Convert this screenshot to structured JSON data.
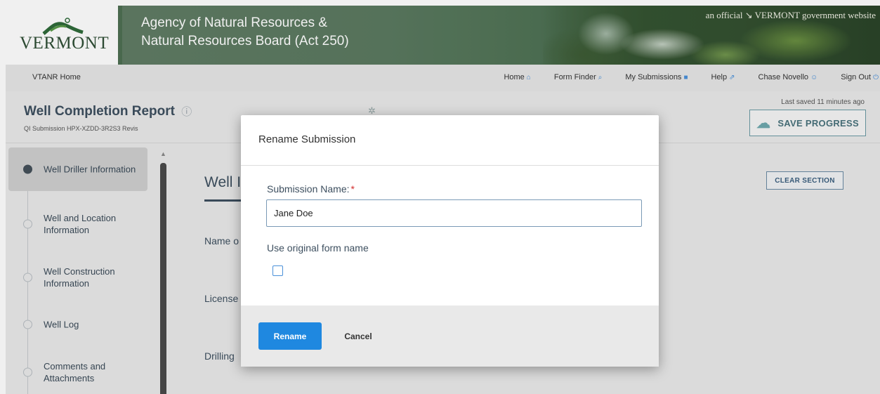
{
  "banner": {
    "logo_text": "VERMONT",
    "agency_line1": "Agency of Natural Resources &",
    "agency_line2": "Natural Resources Board (Act 250)",
    "official": "an official ↘ VERMONT government website"
  },
  "nav": {
    "home_link": "VTANR Home",
    "items": [
      {
        "label": "Home",
        "icon": "⌂"
      },
      {
        "label": "Form Finder",
        "icon": "⌕"
      },
      {
        "label": "My Submissions",
        "icon": "■"
      },
      {
        "label": "Help",
        "icon": "⇗"
      },
      {
        "label": "Chase Novello",
        "icon": "☺"
      },
      {
        "label": "Sign Out",
        "icon": "⏻"
      }
    ]
  },
  "page": {
    "title": "Well Completion Report",
    "help_icon": "ⓘ",
    "sub": "QI                    Submission HPX-XZDD-3R2S3   Revis",
    "last_saved": "Last saved 11 minutes ago",
    "save_label": "SAVE PROGRESS"
  },
  "sidebar": {
    "steps": [
      {
        "label": "Well Driller Information",
        "active": true
      },
      {
        "label": "Well and Location Information",
        "active": false
      },
      {
        "label": "Well Construction Information",
        "active": false
      },
      {
        "label": "Well Log",
        "active": false
      },
      {
        "label": "Comments and Attachments",
        "active": false
      }
    ]
  },
  "content": {
    "section_title": "Well I",
    "clear_label": "CLEAR SECTION",
    "fields": [
      "Name o",
      "License",
      "Drilling"
    ]
  },
  "modal": {
    "title": "Rename Submission",
    "name_label": "Submission Name:",
    "required_mark": "*",
    "name_value": "Jane Doe",
    "use_original_label": "Use original form name",
    "use_original_checked": false,
    "rename_label": "Rename",
    "cancel_label": "Cancel"
  }
}
